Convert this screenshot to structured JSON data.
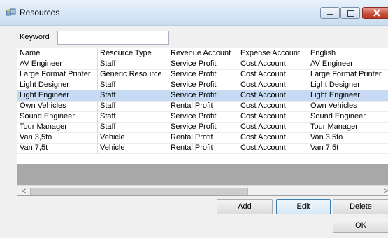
{
  "window": {
    "title": "Resources"
  },
  "keyword": {
    "label": "Keyword",
    "value": ""
  },
  "table": {
    "columns": [
      "Name",
      "Resource Type",
      "Revenue Account",
      "Expense Account",
      "English"
    ],
    "rows": [
      [
        "AV Engineer",
        "Staff",
        "Service Profit",
        "Cost Account",
        "AV Engineer"
      ],
      [
        "Large Format Printer",
        "Generic Resource",
        "Service Profit",
        "Cost Account",
        "Large Format Printer"
      ],
      [
        "Light Designer",
        "Staff",
        "Service Profit",
        "Cost Account",
        "Light Designer"
      ],
      [
        "Light Engineer",
        "Staff",
        "Service Profit",
        "Cost Account",
        "Light Engineer"
      ],
      [
        "Own Vehicles",
        "Staff",
        "Rental Profit",
        "Cost Account",
        "Own Vehicles"
      ],
      [
        "Sound Engineer",
        "Staff",
        "Service Profit",
        "Cost Account",
        "Sound Engineer"
      ],
      [
        "Tour Manager",
        "Staff",
        "Service Profit",
        "Cost Account",
        "Tour Manager"
      ],
      [
        "Van 3,5to",
        "Vehicle",
        "Rental Profit",
        "Cost Account",
        "Van 3,5to"
      ],
      [
        "Van 7,5t",
        "Vehicle",
        "Rental Profit",
        "Cost Account",
        "Van 7,5t"
      ]
    ],
    "selected_row": 3
  },
  "scroll": {
    "left_arrow": "<",
    "right_arrow": ">"
  },
  "buttons": {
    "add": "Add",
    "edit": "Edit",
    "delete": "Delete",
    "ok": "OK"
  },
  "icons": {
    "app": "resources-icon",
    "minimize": "minimize-icon",
    "maximize": "maximize-icon",
    "close": "close-icon"
  },
  "colors": {
    "selection": "#c6dbf3",
    "close_button": "#c8503c"
  }
}
